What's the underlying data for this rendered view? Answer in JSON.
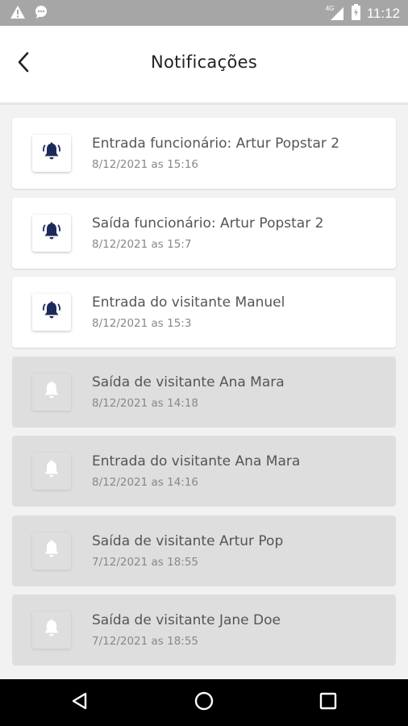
{
  "status_bar": {
    "time": "11:12",
    "network": "4G",
    "icons": [
      "warning-icon",
      "chat-icon",
      "signal-icon",
      "battery-charging-icon"
    ]
  },
  "header": {
    "title": "Notificações",
    "back_icon": "back-arrow-icon"
  },
  "notifications": [
    {
      "title": "Entrada funcionário: Artur Popstar 2",
      "date": "8/12/2021 as 15:16",
      "read": false
    },
    {
      "title": "Saída funcionário: Artur Popstar 2",
      "date": "8/12/2021 as 15:7",
      "read": false
    },
    {
      "title": "Entrada do visitante Manuel",
      "date": "8/12/2021 as 15:3",
      "read": false
    },
    {
      "title": "Saída de visitante Ana Mara",
      "date": "8/12/2021 as 14:18",
      "read": true
    },
    {
      "title": "Entrada do visitante Ana Mara",
      "date": "8/12/2021 as 14:16",
      "read": true
    },
    {
      "title": "Saída de visitante Artur Pop",
      "date": "7/12/2021 as 18:55",
      "read": true
    },
    {
      "title": "Saída de visitante Jane Doe",
      "date": "7/12/2021 as 18:55",
      "read": true
    }
  ],
  "nav_bar": {
    "icons": [
      "back-triangle-icon",
      "home-circle-icon",
      "recents-square-icon"
    ]
  },
  "colors": {
    "unread_bell": "#1c2a5a",
    "read_bell": "#ffffff",
    "unread_card": "#ffffff",
    "read_card": "#dedede",
    "status_bar": "#a6a6a6"
  }
}
